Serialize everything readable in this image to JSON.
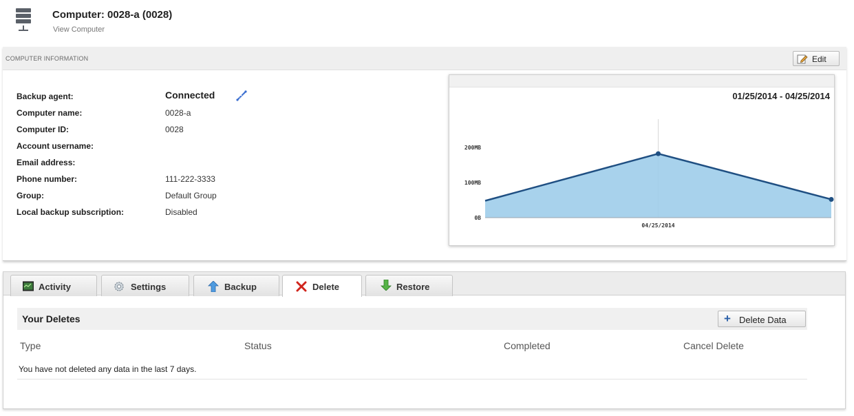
{
  "header": {
    "title": "Computer: 0028-a (0028)",
    "subtitle": "View Computer",
    "icon": "server-icon"
  },
  "info": {
    "section_label": "COMPUTER INFORMATION",
    "edit_label": "Edit",
    "fields": [
      {
        "label": "Backup agent:",
        "value": "Connected"
      },
      {
        "label": "Computer name:",
        "value": "0028-a"
      },
      {
        "label": "Computer ID:",
        "value": "0028"
      },
      {
        "label": "Account username:",
        "value": ""
      },
      {
        "label": "Email address:",
        "value": ""
      },
      {
        "label": "Phone number:",
        "value": "111-222-3333"
      },
      {
        "label": "Group:",
        "value": "Default Group"
      },
      {
        "label": "Local backup subscription:",
        "value": "Disabled"
      }
    ]
  },
  "chart": {
    "date_range": "01/25/2014 - 04/25/2014",
    "colors": {
      "fill": "#9fcdea",
      "line": "#1f4f82",
      "marker": "#1f4f82"
    }
  },
  "chart_data": {
    "type": "area",
    "x": [
      "",
      "04/25/2014",
      ""
    ],
    "values": [
      48,
      182,
      52
    ],
    "y_tick_labels": [
      "0B",
      "100MB",
      "200MB"
    ],
    "y_ticks": [
      0,
      100,
      200
    ],
    "ylim": [
      0,
      245
    ],
    "x_tick_labels": [
      "04/25/2014"
    ],
    "grid": false
  },
  "tabs": [
    {
      "label": "Activity",
      "icon": "monitor-icon",
      "active": false
    },
    {
      "label": "Settings",
      "icon": "gear-icon",
      "active": false
    },
    {
      "label": "Backup",
      "icon": "up-arrow-icon",
      "active": false
    },
    {
      "label": "Delete",
      "icon": "x-icon",
      "active": true
    },
    {
      "label": "Restore",
      "icon": "down-arrow-icon",
      "active": false
    }
  ],
  "deletes": {
    "title": "Your Deletes",
    "add_button_label": "Delete Data",
    "columns": [
      "Type",
      "Status",
      "Completed",
      "Cancel Delete"
    ],
    "empty_message": "You have not deleted any data in the last 7 days."
  }
}
